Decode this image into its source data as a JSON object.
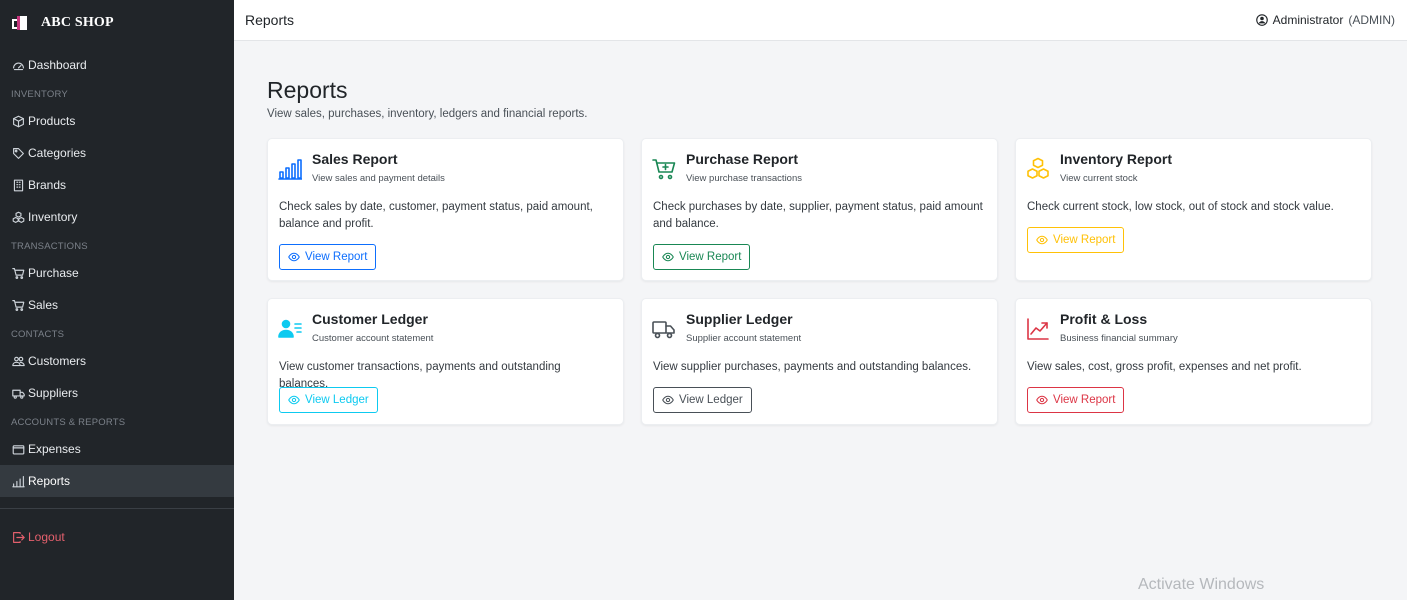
{
  "brand": {
    "name": "ABC SHOP"
  },
  "sidebar": {
    "dashboard": "Dashboard",
    "sections": {
      "inventory": "INVENTORY",
      "transactions": "TRANSACTIONS",
      "contacts": "CONTACTS",
      "accounts": "ACCOUNTS & REPORTS"
    },
    "items": {
      "products": "Products",
      "categories": "Categories",
      "brands": "Brands",
      "inventory": "Inventory",
      "purchase": "Purchase",
      "sales": "Sales",
      "customers": "Customers",
      "suppliers": "Suppliers",
      "expenses": "Expenses",
      "reports": "Reports"
    },
    "logout": "Logout",
    "active": "reports"
  },
  "topbar": {
    "title": "Reports",
    "user_name": "Administrator",
    "user_role": "(ADMIN)"
  },
  "page": {
    "title": "Reports",
    "subtitle": "View sales, purchases, inventory, ledgers and financial reports."
  },
  "cards": [
    {
      "id": "sales",
      "title": "Sales Report",
      "subtitle": "View sales and payment details",
      "text": "Check sales by date, customer, payment status, paid amount, balance and profit.",
      "button": "View Report",
      "color": "#0d6efd",
      "icon": "bar-chart-icon"
    },
    {
      "id": "purchase",
      "title": "Purchase Report",
      "subtitle": "View purchase transactions",
      "text": "Check purchases by date, supplier, payment status, paid amount and balance.",
      "button": "View Report",
      "color": "#198754",
      "icon": "cart-plus-icon"
    },
    {
      "id": "inventory",
      "title": "Inventory Report",
      "subtitle": "View current stock",
      "text": "Check current stock, low stock, out of stock and stock value.",
      "button": "View Report",
      "color": "#ffc107",
      "icon": "boxes-icon"
    },
    {
      "id": "customer-ledger",
      "title": "Customer Ledger",
      "subtitle": "Customer account statement",
      "text": "View customer transactions, payments and outstanding balances.",
      "button": "View Ledger",
      "color": "#0dcaf0",
      "icon": "person-lines-icon"
    },
    {
      "id": "supplier-ledger",
      "title": "Supplier Ledger",
      "subtitle": "Supplier account statement",
      "text": "View supplier purchases, payments and outstanding balances.",
      "button": "View Ledger",
      "color": "#495057",
      "icon": "truck-icon"
    },
    {
      "id": "profit-loss",
      "title": "Profit & Loss",
      "subtitle": "Business financial summary",
      "text": "View sales, cost, gross profit, expenses and net profit.",
      "button": "View Report",
      "color": "#dc3545",
      "icon": "graph-up-icon"
    }
  ],
  "watermark": "Activate Windows"
}
